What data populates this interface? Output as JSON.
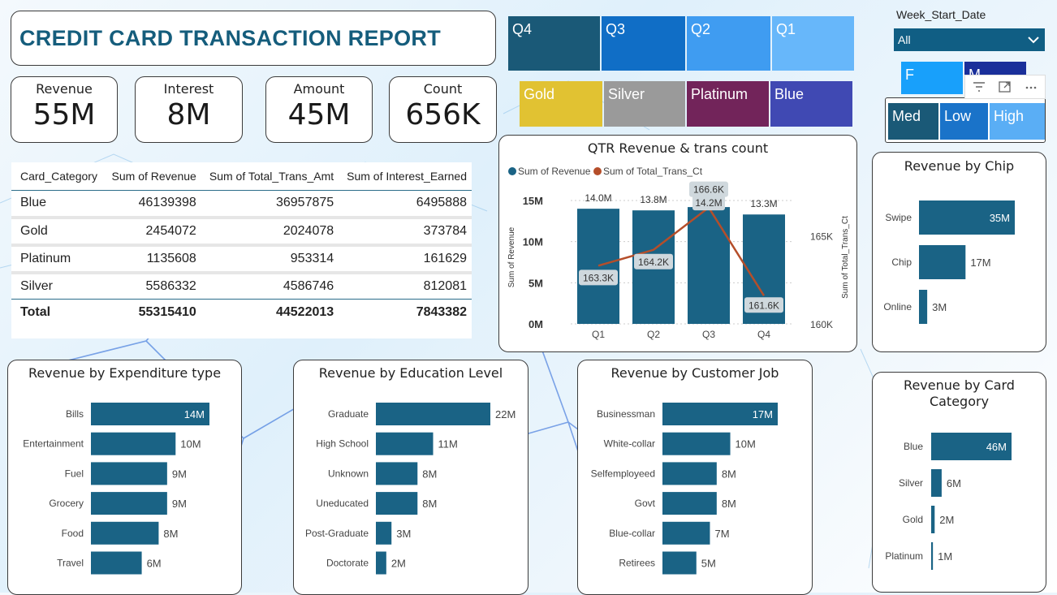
{
  "header": {
    "title": "CREDIT CARD TRANSACTION REPORT"
  },
  "kpis": [
    {
      "label": "Revenue",
      "value": "55M"
    },
    {
      "label": "Interest",
      "value": "8M"
    },
    {
      "label": "Amount",
      "value": "45M"
    },
    {
      "label": "Count",
      "value": "656K"
    }
  ],
  "table": {
    "headers": [
      "Card_Category",
      "Sum of Revenue",
      "Sum of Total_Trans_Amt",
      "Sum of Interest_Earned"
    ],
    "rows": [
      [
        "Blue",
        "46139398",
        "36957875",
        "6495888"
      ],
      [
        "Gold",
        "2454072",
        "2024078",
        "373784"
      ],
      [
        "Platinum",
        "1135608",
        "953314",
        "161629"
      ],
      [
        "Silver",
        "5586332",
        "4586746",
        "812081"
      ]
    ],
    "total": [
      "Total",
      "55315410",
      "44522013",
      "7843382"
    ]
  },
  "slicers": {
    "quarters": [
      {
        "label": "Q4",
        "color": "#1a5977"
      },
      {
        "label": "Q3",
        "color": "#106ec6"
      },
      {
        "label": "Q2",
        "color": "#3f9cf1"
      },
      {
        "label": "Q1",
        "color": "#67b7fa"
      }
    ],
    "cards": [
      {
        "label": "Gold",
        "color": "#e1c232"
      },
      {
        "label": "Silver",
        "color": "#9a9a9a"
      },
      {
        "label": "Platinum",
        "color": "#72245a"
      },
      {
        "label": "Blue",
        "color": "#4049b3"
      }
    ],
    "gender": [
      {
        "label": "F",
        "color": "#18a0fb"
      },
      {
        "label": "M",
        "color": "#1a2f9a"
      }
    ],
    "income": [
      {
        "label": "Med",
        "color": "#1a5977"
      },
      {
        "label": "Low",
        "color": "#1a73c9"
      },
      {
        "label": "High",
        "color": "#5aaef5"
      }
    ],
    "week_label": "Week_Start_Date",
    "week_value": "All"
  },
  "colors": {
    "bar": "#1a6385",
    "line": "#b54e2a",
    "accent": "#155d7c"
  },
  "chart_data": [
    {
      "id": "qtr",
      "type": "bar",
      "title": "QTR Revenue & trans count",
      "categories": [
        "Q1",
        "Q2",
        "Q3",
        "Q4"
      ],
      "series": [
        {
          "name": "Sum of Revenue",
          "values": [
            14.0,
            13.8,
            14.2,
            13.3
          ],
          "labels": [
            "14.0M",
            "13.8M",
            "14.2M",
            "13.3M"
          ]
        },
        {
          "name": "Sum of Total_Trans_Ct",
          "values": [
            163.3,
            164.2,
            166.6,
            161.6
          ],
          "labels": [
            "163.3K",
            "164.2K",
            "166.6K",
            "161.6K"
          ]
        }
      ],
      "ylabel": "Sum of Revenue",
      "y2label": "Sum of Total_Trans_Ct",
      "yticks": [
        "0M",
        "5M",
        "10M",
        "15M"
      ],
      "y2ticks": [
        "160K",
        "165K"
      ],
      "ylim": [
        0,
        15
      ],
      "y2lim": [
        160,
        167
      ]
    },
    {
      "id": "chip",
      "type": "bar",
      "title": "Revenue by Chip",
      "categories": [
        "Swipe",
        "Chip",
        "Online"
      ],
      "values": [
        35,
        17,
        3
      ],
      "labels": [
        "35M",
        "17M",
        "3M"
      ]
    },
    {
      "id": "exp",
      "type": "bar",
      "title": "Revenue by Expenditure type",
      "categories": [
        "Bills",
        "Entertainment",
        "Fuel",
        "Grocery",
        "Food",
        "Travel"
      ],
      "values": [
        14,
        10,
        9,
        9,
        8,
        6
      ],
      "labels": [
        "14M",
        "10M",
        "9M",
        "9M",
        "8M",
        "6M"
      ]
    },
    {
      "id": "edu",
      "type": "bar",
      "title": "Revenue by Education Level",
      "categories": [
        "Graduate",
        "High School",
        "Unknown",
        "Uneducated",
        "Post-Graduate",
        "Doctorate"
      ],
      "values": [
        22,
        11,
        8,
        8,
        3,
        2
      ],
      "labels": [
        "22M",
        "11M",
        "8M",
        "8M",
        "3M",
        "2M"
      ]
    },
    {
      "id": "job",
      "type": "bar",
      "title": "Revenue by Customer Job",
      "categories": [
        "Businessman",
        "White-collar",
        "Selfemployeed",
        "Govt",
        "Blue-collar",
        "Retirees"
      ],
      "values": [
        17,
        10,
        8,
        8,
        7,
        5
      ],
      "labels": [
        "17M",
        "10M",
        "8M",
        "8M",
        "7M",
        "5M"
      ]
    },
    {
      "id": "cardcat",
      "type": "bar",
      "title": "Revenue by Card Category",
      "categories": [
        "Blue",
        "Silver",
        "Gold",
        "Platinum"
      ],
      "values": [
        46,
        6,
        2,
        1
      ],
      "labels": [
        "46M",
        "6M",
        "2M",
        "1M"
      ]
    }
  ]
}
